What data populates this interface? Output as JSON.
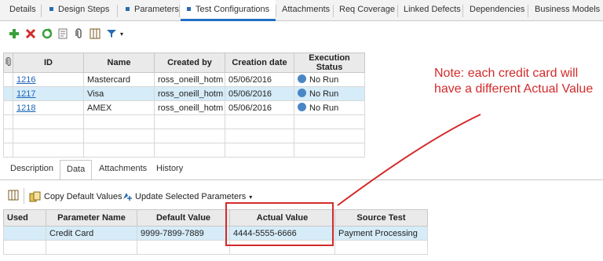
{
  "top_tabs": [
    {
      "label": "Details",
      "marker": false,
      "active": false
    },
    {
      "label": "Design Steps",
      "marker": true,
      "active": false
    },
    {
      "label": "Parameters",
      "marker": true,
      "active": false
    },
    {
      "label": "Test Configurations",
      "marker": true,
      "active": true
    },
    {
      "label": "Attachments",
      "marker": false,
      "active": false
    },
    {
      "label": "Req Coverage",
      "marker": false,
      "active": false
    },
    {
      "label": "Linked Defects",
      "marker": false,
      "active": false
    },
    {
      "label": "Dependencies",
      "marker": false,
      "active": false
    },
    {
      "label": "Business Models Li",
      "marker": false,
      "active": false
    }
  ],
  "toolbar_icons": [
    "add-icon",
    "delete-icon",
    "refresh-icon",
    "details-icon",
    "attach-icon",
    "columns-icon",
    "filter-icon"
  ],
  "config_table": {
    "headers": [
      "ID",
      "Name",
      "Created by",
      "Creation date",
      "Execution Status"
    ],
    "rows": [
      {
        "id": "1216",
        "name": "Mastercard",
        "created_by": "ross_oneill_hotm",
        "date": "05/06/2016",
        "status": "No Run",
        "selected": false
      },
      {
        "id": "1217",
        "name": "Visa",
        "created_by": "ross_oneill_hotm",
        "date": "05/06/2016",
        "status": "No Run",
        "selected": true
      },
      {
        "id": "1218",
        "name": "AMEX",
        "created_by": "ross_oneill_hotm",
        "date": "05/06/2016",
        "status": "No Run",
        "selected": false
      }
    ]
  },
  "bottom_tabs": [
    {
      "label": "Description",
      "active": false
    },
    {
      "label": "Data",
      "active": true
    },
    {
      "label": "Attachments",
      "active": false
    },
    {
      "label": "History",
      "active": false
    }
  ],
  "data_toolbar": {
    "copy_label": "Copy Default Values",
    "update_label": "Update Selected Parameters"
  },
  "param_table": {
    "headers": [
      "Used",
      "Parameter Name",
      "Default Value",
      "Actual Value",
      "Source Test"
    ],
    "rows": [
      {
        "used": "",
        "name": "Credit Card",
        "default": "9999-7899-7889",
        "actual": "4444-5555-6666",
        "source": "Payment Processing"
      }
    ]
  },
  "annotation": {
    "text": "Note: each credit card will have a different Actual Value",
    "color": "#d42a2a"
  },
  "colors": {
    "accent": "#1f6fc5",
    "selected_row": "#d6ecf8"
  }
}
